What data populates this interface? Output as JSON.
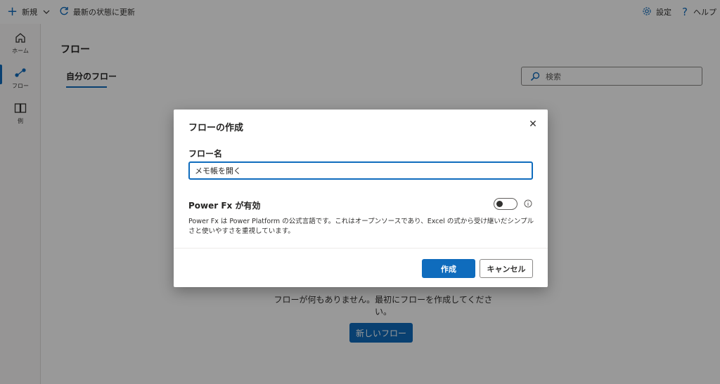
{
  "topbar": {
    "new_label": "新規",
    "refresh_label": "最新の状態に更新",
    "settings_label": "設定",
    "help_label": "ヘルプ"
  },
  "rail": {
    "home_label": "ホーム",
    "flows_label": "フロー",
    "examples_label": "例"
  },
  "main": {
    "page_title": "フロー",
    "tab_my_flows": "自分のフロー",
    "search_placeholder": "検索",
    "empty_message": "フローが何もありません。最初にフローを作成してください。",
    "new_flow_button": "新しいフロー"
  },
  "dialog": {
    "title": "フローの作成",
    "close_symbol": "✕",
    "name_label": "フロー名",
    "name_value": "メモ帳を開く",
    "powerfx_label": "Power Fx が有効",
    "powerfx_enabled": false,
    "description": "Power Fx は Power Platform の公式言語です。これはオープンソースであり、Excel の式から受け継いだシンプルさと使いやすさを重視しています。",
    "create_button": "作成",
    "cancel_button": "キャンセル"
  },
  "colors": {
    "accent": "#0f6cbd",
    "overlay": "rgba(0,0,0,0.4)"
  }
}
